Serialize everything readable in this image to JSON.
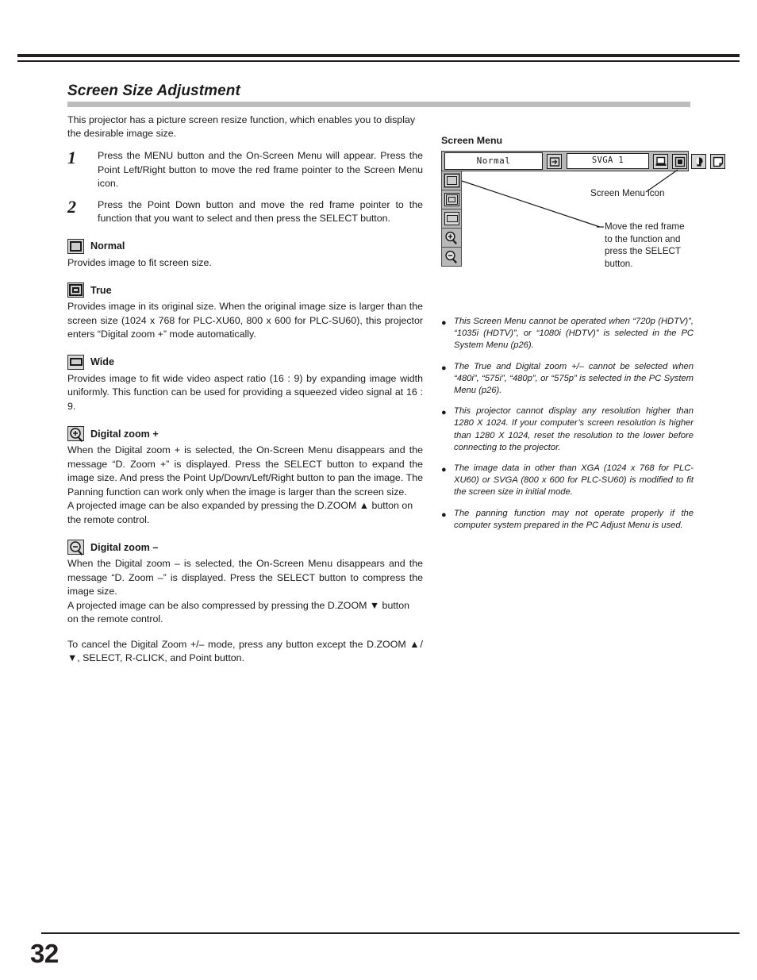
{
  "page": {
    "number": "32"
  },
  "section": {
    "title": "Screen Size Adjustment",
    "intro": "This projector has a picture screen resize function, which enables you to display the desirable image size."
  },
  "steps": [
    {
      "num": "1",
      "text": "Press the MENU button and the On-Screen Menu will appear. Press the Point Left/Right button to move the red frame pointer to the Screen Menu icon."
    },
    {
      "num": "2",
      "text": "Press the Point Down button and move the red frame pointer to the function that you want to select and then press the SELECT button."
    }
  ],
  "functions": [
    {
      "icon": "normal-screen-icon",
      "label": "Normal",
      "paragraphs": [
        "Provides image to fit screen size."
      ]
    },
    {
      "icon": "true-screen-icon",
      "label": "True",
      "paragraphs": [
        "Provides image in its original size.  When the original image size is larger than the screen size (1024 x 768 for PLC-XU60, 800 x 600 for PLC-SU60), this projector enters “Digital zoom +” mode automatically."
      ]
    },
    {
      "icon": "wide-screen-icon",
      "label": "Wide",
      "paragraphs": [
        "Provides image to fit wide video aspect ratio (16 : 9) by expanding image width uniformly.  This function can be used for providing a squeezed video signal at 16 : 9."
      ]
    },
    {
      "icon": "zoom-in-icon",
      "label": "Digital zoom +",
      "paragraphs": [
        "When the Digital zoom + is selected, the On-Screen Menu disappears and the message “D. Zoom +” is displayed.  Press the SELECT button to expand the image size.  And press the Point Up/Down/Left/Right button to pan the image.  The Panning function can work only when the image is larger than the screen size.",
        "A projected image can be also expanded by pressing the D.ZOOM ▲ button on the remote control."
      ]
    },
    {
      "icon": "zoom-out-icon",
      "label": "Digital zoom –",
      "paragraphs": [
        "When the Digital zoom – is selected, the On-Screen Menu disappears and the message “D. Zoom –” is displayed.  Press the SELECT button to compress the image size.",
        "A projected image can be also compressed by pressing the D.ZOOM ▼ button on the remote control."
      ]
    }
  ],
  "closing": "To cancel the Digital Zoom +/– mode, press any button except the D.ZOOM ▲/▼, SELECT, R-CLICK, and Point button.",
  "screen_menu": {
    "heading": "Screen Menu",
    "value": "Normal",
    "system_value": "SVGA 1",
    "bar_icons": [
      "input-source-icon",
      "computer-icon",
      "image-icon",
      "image-adjust-icon",
      "screen-icon"
    ],
    "stack_items": [
      "normal-screen-icon",
      "true-screen-icon",
      "wide-screen-icon",
      "zoom-in-icon",
      "zoom-out-icon"
    ],
    "callout_icon_label": "Screen Menu icon",
    "callout_frame_label": "Move the red frame to the function and press the SELECT button."
  },
  "notes": [
    "This Screen Menu cannot be operated when “720p (HDTV)”, “1035i (HDTV)”, or “1080i (HDTV)” is selected in the PC System Menu  (p26).",
    "The True and Digital zoom +/– cannot be selected when “480i”, “575i”, “480p”, or “575p” is selected in the PC System Menu  (p26).",
    "This projector cannot display any resolution higher than 1280 X 1024.  If your computer’s screen resolution is higher than 1280 X 1024, reset the resolution to the lower before connecting to the projector.",
    "The image data in other than XGA (1024 x 768 for PLC-XU60) or SVGA (800 x 600 for PLC-SU60) is modified to fit the screen size in initial mode.",
    "The panning function may not operate properly if the computer system prepared in the PC Adjust Menu is used."
  ],
  "colors": {
    "rule": "#231f20",
    "title_bar": "#bcbcbc",
    "menu_gray": "#b8b8b8"
  }
}
